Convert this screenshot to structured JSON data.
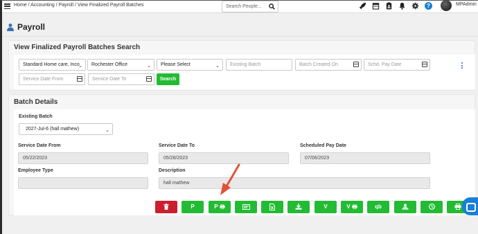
{
  "breadcrumb": {
    "home": "Home",
    "sep": " / ",
    "accounting": "Accounting",
    "payroll": "Payroll",
    "current": "View Finalized Payroll Batches"
  },
  "topbar": {
    "search_placeholder": "Search People...",
    "username": "MPAdmin",
    "help_glyph": "?"
  },
  "page": {
    "title": "Payroll"
  },
  "search_section": {
    "title": "View Finalized Payroll Batches Search",
    "agency_value": "Standard Home care, Inco",
    "office_value": "Rochester Office",
    "status_value": "Please Select",
    "existing_batch_placeholder": "Existing Batch",
    "batch_created_placeholder": "Batch Created On",
    "schd_pay_date_placeholder": "Schd. Pay Date",
    "service_from_placeholder": "Service Date From",
    "service_to_placeholder": "Service Date To",
    "search_button": "Search"
  },
  "batch_details": {
    "title": "Batch Details",
    "existing_batch_label": "Existing Batch",
    "existing_batch_value": "2027-Jul-6 (hall mathew)",
    "service_from_label": "Service Date From",
    "service_from_value": "05/22/2023",
    "service_to_label": "Service Date To",
    "service_to_value": "05/28/2023",
    "scheduled_pay_label": "Scheduled Pay Date",
    "scheduled_pay_value": "07/06/2023",
    "employee_type_label": "Employee Type",
    "employee_type_value": "",
    "description_label": "Description",
    "description_value": "hall mathew"
  },
  "actions": {
    "p_label": "P",
    "p_print_label": "P",
    "v_label": "V",
    "v_print_label": "V",
    "qb_label": "qb"
  },
  "colors": {
    "green": "#22bb33",
    "red": "#cc1f2d",
    "arrow": "#e0533a",
    "accent_blue": "#1a7fd6"
  }
}
